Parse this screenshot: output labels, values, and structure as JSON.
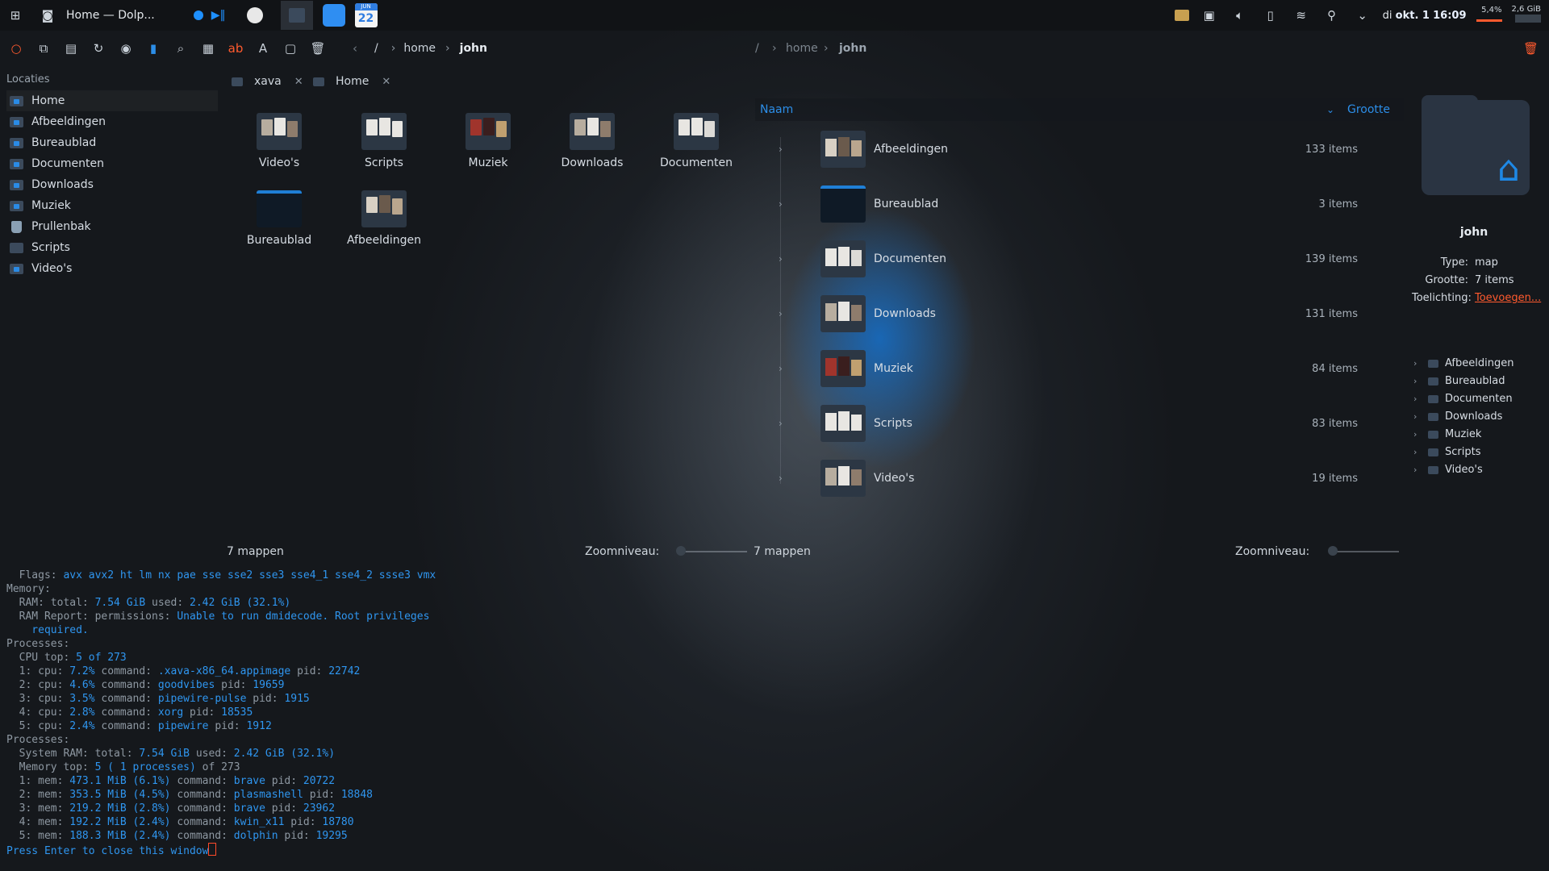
{
  "panel": {
    "window_title": "Home — Dolp...",
    "calendar_month": "JUN",
    "calendar_day": "22",
    "clock_prefix": "di",
    "clock_date": "okt. 1",
    "clock_time": "16:09",
    "cpu": "5,4%",
    "mem": "2,6 GiB"
  },
  "toolbar": {
    "breadcrumb_left": [
      "/",
      "home",
      "john"
    ],
    "breadcrumb_right": [
      "/",
      "home",
      "john"
    ]
  },
  "sidebar": {
    "title": "Locaties",
    "items": [
      {
        "label": "Home"
      },
      {
        "label": "Afbeeldingen"
      },
      {
        "label": "Bureaublad"
      },
      {
        "label": "Documenten"
      },
      {
        "label": "Downloads"
      },
      {
        "label": "Muziek"
      },
      {
        "label": "Prullenbak"
      },
      {
        "label": "Scripts"
      },
      {
        "label": "Video's"
      }
    ]
  },
  "tabs": [
    {
      "label": "xava"
    },
    {
      "label": "Home"
    }
  ],
  "iconview": {
    "items": [
      {
        "label": "Video's"
      },
      {
        "label": "Scripts"
      },
      {
        "label": "Muziek"
      },
      {
        "label": "Downloads"
      },
      {
        "label": "Documenten"
      },
      {
        "label": "Bureaublad"
      },
      {
        "label": "Afbeeldingen"
      }
    ],
    "status": "7 mappen",
    "zoom_label": "Zoomniveau:"
  },
  "detailsview": {
    "col_name": "Naam",
    "col_size": "Grootte",
    "rows": [
      {
        "name": "Afbeeldingen",
        "size": "133 items"
      },
      {
        "name": "Bureaublad",
        "size": "3 items"
      },
      {
        "name": "Documenten",
        "size": "139 items"
      },
      {
        "name": "Downloads",
        "size": "131 items"
      },
      {
        "name": "Muziek",
        "size": "84 items"
      },
      {
        "name": "Scripts",
        "size": "83 items"
      },
      {
        "name": "Video's",
        "size": "19 items"
      }
    ],
    "status": "7 mappen",
    "zoom_label": "Zoomniveau:"
  },
  "info": {
    "name": "john",
    "type_key": "Type:",
    "type_val": "map",
    "size_key": "Grootte:",
    "size_val": "7 items",
    "note_key": "Toelichting:",
    "note_val": "Toevoegen...",
    "tree": [
      "Afbeeldingen",
      "Bureaublad",
      "Documenten",
      "Downloads",
      "Muziek",
      "Scripts",
      "Video's"
    ]
  },
  "terminal": {
    "lines": [
      [
        {
          "t": "  Flags: "
        },
        {
          "t": "avx avx2 ht lm nx pae sse sse2 sse3 sse4_1 sse4_2 ssse3 vmx",
          "v": 1
        }
      ],
      [
        {
          "t": "Memory:"
        }
      ],
      [
        {
          "t": "  RAM: total: "
        },
        {
          "t": "7.54 GiB",
          "v": 1
        },
        {
          "t": " used: "
        },
        {
          "t": "2.42 GiB (32.1%)",
          "v": 1
        }
      ],
      [
        {
          "t": "  RAM Report: permissions: "
        },
        {
          "t": "Unable to run dmidecode. Root privileges",
          "v": 1
        }
      ],
      [
        {
          "t": "    required.",
          "v": 1
        }
      ],
      [
        {
          "t": "Processes:"
        }
      ],
      [
        {
          "t": "  CPU top: "
        },
        {
          "t": "5 of 273",
          "v": 1
        }
      ],
      [
        {
          "t": "  1: cpu: "
        },
        {
          "t": "7.2%",
          "v": 1
        },
        {
          "t": " command: "
        },
        {
          "t": ".xava-x86_64.appimage",
          "v": 1
        },
        {
          "t": " pid: "
        },
        {
          "t": "22742",
          "v": 1
        }
      ],
      [
        {
          "t": "  2: cpu: "
        },
        {
          "t": "4.6%",
          "v": 1
        },
        {
          "t": " command: "
        },
        {
          "t": "goodvibes",
          "v": 1
        },
        {
          "t": " pid: "
        },
        {
          "t": "19659",
          "v": 1
        }
      ],
      [
        {
          "t": "  3: cpu: "
        },
        {
          "t": "3.5%",
          "v": 1
        },
        {
          "t": " command: "
        },
        {
          "t": "pipewire-pulse",
          "v": 1
        },
        {
          "t": " pid: "
        },
        {
          "t": "1915",
          "v": 1
        }
      ],
      [
        {
          "t": "  4: cpu: "
        },
        {
          "t": "2.8%",
          "v": 1
        },
        {
          "t": " command: "
        },
        {
          "t": "xorg",
          "v": 1
        },
        {
          "t": " pid: "
        },
        {
          "t": "18535",
          "v": 1
        }
      ],
      [
        {
          "t": "  5: cpu: "
        },
        {
          "t": "2.4%",
          "v": 1
        },
        {
          "t": " command: "
        },
        {
          "t": "pipewire",
          "v": 1
        },
        {
          "t": " pid: "
        },
        {
          "t": "1912",
          "v": 1
        }
      ],
      [
        {
          "t": "Processes:"
        }
      ],
      [
        {
          "t": "  System RAM: total: "
        },
        {
          "t": "7.54 GiB",
          "v": 1
        },
        {
          "t": " used: "
        },
        {
          "t": "2.42 GiB (32.1%)",
          "v": 1
        }
      ],
      [
        {
          "t": "  Memory top: "
        },
        {
          "t": "5 ( 1 processes)",
          "v": 1
        },
        {
          "t": " of 273"
        }
      ],
      [
        {
          "t": "  1: mem: "
        },
        {
          "t": "473.1 MiB (6.1%)",
          "v": 1
        },
        {
          "t": " command: "
        },
        {
          "t": "brave",
          "v": 1
        },
        {
          "t": " pid: "
        },
        {
          "t": "20722",
          "v": 1
        }
      ],
      [
        {
          "t": "  2: mem: "
        },
        {
          "t": "353.5 MiB (4.5%)",
          "v": 1
        },
        {
          "t": " command: "
        },
        {
          "t": "plasmashell",
          "v": 1
        },
        {
          "t": " pid: "
        },
        {
          "t": "18848",
          "v": 1
        }
      ],
      [
        {
          "t": "  3: mem: "
        },
        {
          "t": "219.2 MiB (2.8%)",
          "v": 1
        },
        {
          "t": " command: "
        },
        {
          "t": "brave",
          "v": 1
        },
        {
          "t": " pid: "
        },
        {
          "t": "23962",
          "v": 1
        }
      ],
      [
        {
          "t": "  4: mem: "
        },
        {
          "t": "192.2 MiB (2.4%)",
          "v": 1
        },
        {
          "t": " command: "
        },
        {
          "t": "kwin_x11",
          "v": 1
        },
        {
          "t": " pid: "
        },
        {
          "t": "18780",
          "v": 1
        }
      ],
      [
        {
          "t": "  5: mem: "
        },
        {
          "t": "188.3 MiB (2.4%)",
          "v": 1
        },
        {
          "t": " command: "
        },
        {
          "t": "dolphin",
          "v": 1
        },
        {
          "t": " pid: "
        },
        {
          "t": "19295",
          "v": 1
        }
      ]
    ],
    "prompt": "Press Enter to close this window"
  },
  "colors": {
    "accent": "#2c8ee8",
    "link": "#ff5a2e"
  }
}
